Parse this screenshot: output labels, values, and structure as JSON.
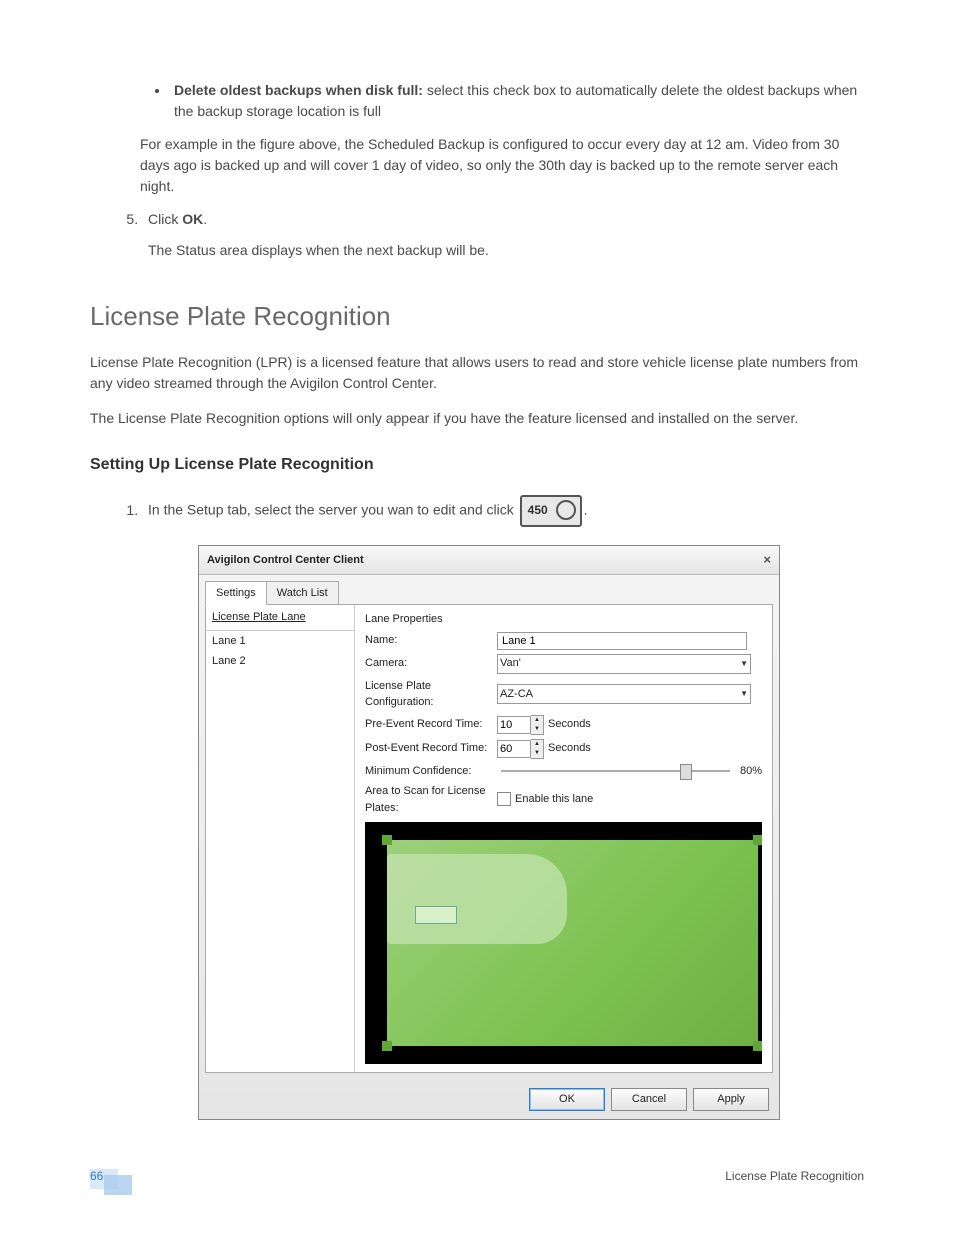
{
  "doc": {
    "bullet_bold": "Delete oldest backups when disk full:",
    "bullet_rest": " select this check box to automatically delete the oldest backups when the backup storage location is full",
    "para_example": "For example in the figure above, the Scheduled Backup is configured to occur every day at 12 am. Video from 30 days ago is backed up and will cover 1 day of video, so only the 30th day is backed up to the remote server each night.",
    "step5_prefix": "Click ",
    "step5_bold": "OK",
    "step5_suffix": ".",
    "step5_result": "The Status area displays when the next backup will be.",
    "h2": "License Plate Recognition",
    "lpr_p1": "License Plate Recognition (LPR) is a licensed feature that allows users to read and store vehicle license plate numbers from any video streamed through the Avigilon Control Center.",
    "lpr_p2": "The License Plate Recognition options will only appear if you have the feature licensed and installed on the server.",
    "h3": "Setting Up License Plate Recognition",
    "step1_a": "In the Setup tab, select the server you wan to edit and click ",
    "step1_b": ".",
    "icon_num": "450"
  },
  "win": {
    "title": "Avigilon Control Center Client",
    "tabs": {
      "settings": "Settings",
      "watch": "Watch List"
    },
    "lane_col": "License Plate Lane",
    "lanes": [
      "Lane 1",
      "Lane 2"
    ],
    "props_hdr": "Lane Properties",
    "labels": {
      "name": "Name:",
      "camera": "Camera:",
      "config": "License Plate Configuration:",
      "pre": "Pre-Event Record Time:",
      "post": "Post-Event Record Time:",
      "conf": "Minimum Confidence:",
      "area": "Area to Scan for License Plates:"
    },
    "values": {
      "name": "Lane 1",
      "camera": "Van'",
      "config": "AZ-CA",
      "pre": "10",
      "post": "60",
      "seconds": "Seconds",
      "conf_pct": "80%",
      "enable": "Enable this lane"
    },
    "buttons": {
      "ok": "OK",
      "cancel": "Cancel",
      "apply": "Apply"
    }
  },
  "footer": {
    "page": "66",
    "section": "License Plate Recognition"
  }
}
